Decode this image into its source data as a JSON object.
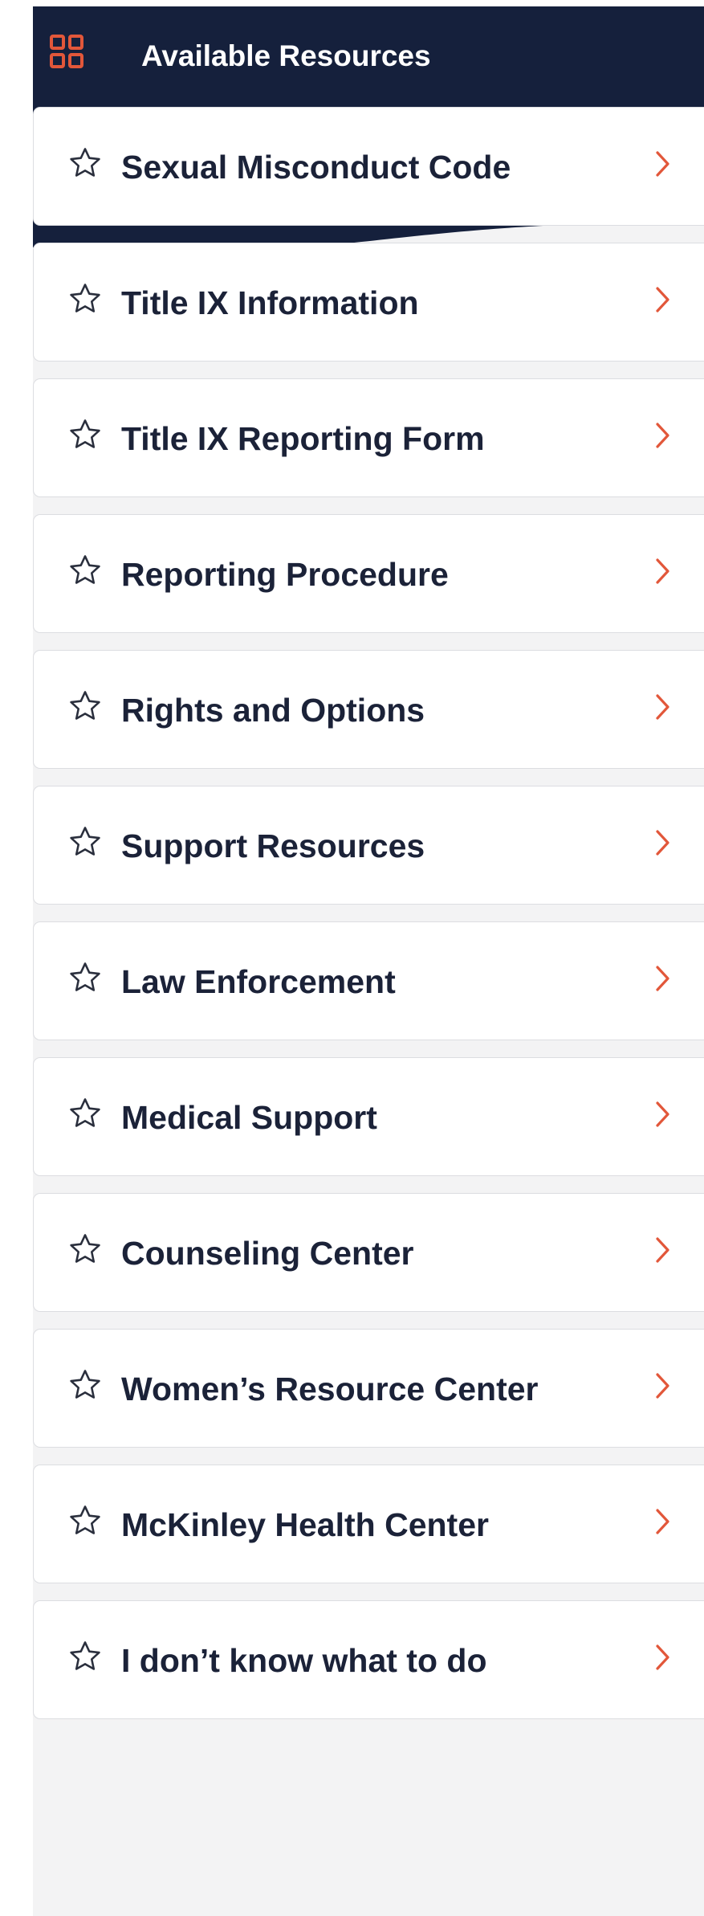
{
  "header": {
    "title": "Available Resources",
    "icon": "grid-icon",
    "background_color": "#15203c",
    "icon_color": "#e2573a"
  },
  "accent_color": "#e2573a",
  "items": [
    {
      "label": "Sexual Misconduct Code",
      "icon": "star-outline-icon",
      "trailing_icon": "chevron-right-icon"
    },
    {
      "label": "Title IX Information",
      "icon": "star-outline-icon",
      "trailing_icon": "chevron-right-icon"
    },
    {
      "label": "Title IX Reporting Form",
      "icon": "star-outline-icon",
      "trailing_icon": "chevron-right-icon"
    },
    {
      "label": "Reporting Procedure",
      "icon": "star-outline-icon",
      "trailing_icon": "chevron-right-icon"
    },
    {
      "label": "Rights and Options",
      "icon": "star-outline-icon",
      "trailing_icon": "chevron-right-icon"
    },
    {
      "label": "Support Resources",
      "icon": "star-outline-icon",
      "trailing_icon": "chevron-right-icon"
    },
    {
      "label": "Law Enforcement",
      "icon": "star-outline-icon",
      "trailing_icon": "chevron-right-icon"
    },
    {
      "label": "Medical Support",
      "icon": "star-outline-icon",
      "trailing_icon": "chevron-right-icon"
    },
    {
      "label": "Counseling Center",
      "icon": "star-outline-icon",
      "trailing_icon": "chevron-right-icon"
    },
    {
      "label": "Women’s Resource Center",
      "icon": "star-outline-icon",
      "trailing_icon": "chevron-right-icon"
    },
    {
      "label": "McKinley Health Center",
      "icon": "star-outline-icon",
      "trailing_icon": "chevron-right-icon"
    },
    {
      "label": "I don’t know what to do",
      "icon": "star-outline-icon",
      "trailing_icon": "chevron-right-icon"
    }
  ]
}
